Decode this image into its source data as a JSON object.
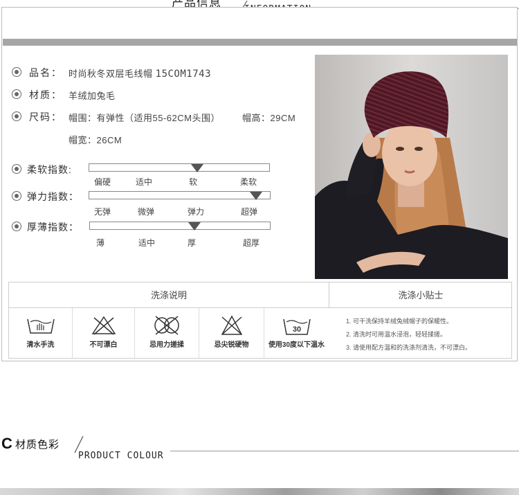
{
  "header": {
    "title_cn": "产品信息",
    "title_en": "INFORMATION"
  },
  "product": {
    "name_label": "品名：",
    "name_value": "时尚秋冬双层毛线帽",
    "name_code": "15COM1743",
    "material_label": "材质：",
    "material_value": "羊绒加兔毛",
    "size_label": "尺码：",
    "size_circumference": "帽围：有弹性（适用55-62CM头围）",
    "size_height": "帽高：29CM",
    "size_width": "帽宽：26CM"
  },
  "meters": [
    {
      "label": "柔软指数:",
      "ticks": [
        "偏硬",
        "适中",
        "软",
        "柔软"
      ],
      "level": 0.6
    },
    {
      "label": "弹力指数：",
      "ticks": [
        "无弹",
        "微弹",
        "弹力",
        "超弹"
      ],
      "level": 0.92
    },
    {
      "label": "厚薄指数：",
      "ticks": [
        "薄",
        "适中",
        "厚",
        "超厚"
      ],
      "level": 0.58
    }
  ],
  "washing": {
    "title": "洗涤说明",
    "tips_title": "洗涤小贴士",
    "icons": [
      {
        "icon": "hand-wash-icon",
        "caption": "清水手洗"
      },
      {
        "icon": "no-bleach-icon",
        "caption": "不可漂白"
      },
      {
        "icon": "no-wring-icon",
        "caption": "忌用力搓揉"
      },
      {
        "icon": "no-sharp-objects-icon",
        "caption": "忌尖锐硬物"
      },
      {
        "icon": "wash-30-icon",
        "caption": "使用30度以下温水",
        "temp": "30"
      }
    ],
    "tips": [
      "1. 可干洗保持羊绒兔绒帽子的保暖性。",
      "2. 清洗时可用温水浸泡，轻轻揉搓。",
      "3. 请使用配方温和的洗涤剂清洗，不可漂白。"
    ]
  },
  "section2": {
    "mark": "C",
    "title_cn": "材质色彩",
    "title_en": "PRODUCT COLOUR"
  },
  "colors": {
    "band": "#a6a6a6",
    "hat": "#5a1f2b",
    "sweater": "#1c1c22"
  }
}
